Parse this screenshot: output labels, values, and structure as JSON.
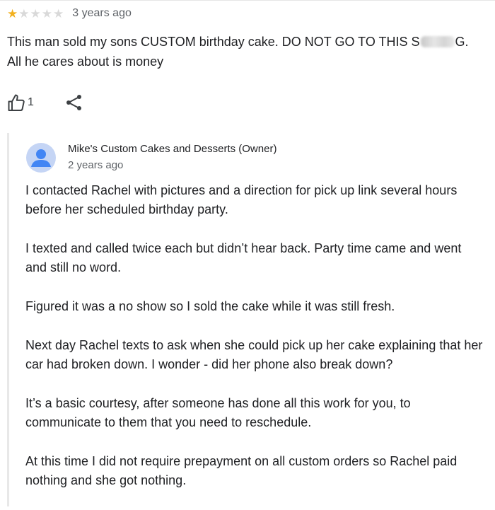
{
  "review": {
    "rating": 1,
    "max_rating": 5,
    "date": "3 years ago",
    "text_part1": "This man sold my sons CUSTOM birthday cake. DO NOT GO TO THIS S",
    "text_part2": "G. All he cares about is money",
    "like_count": "1"
  },
  "reply": {
    "owner_name": "Mike's Custom Cakes and Desserts (Owner)",
    "date": "2 years ago",
    "paragraphs": [
      "I contacted Rachel with pictures and a direction for pick up link several hours before her scheduled birthday party.",
      "I texted and called twice each but didn’t hear back. Party time came and went and still no word.",
      "Figured it was a no show so I sold the cake while it was still fresh.",
      "Next day Rachel texts to ask when she could pick up her cake explaining that her car had broken down. I wonder - did her phone also break down?",
      "It’s a basic courtesy, after someone has done all this work for you, to communicate to them that you need to reschedule.",
      "At this time I did not require prepayment on all custom orders so Rachel paid nothing and she got nothing."
    ]
  },
  "icons": {
    "star": "star-icon",
    "like": "thumbs-up-icon",
    "share": "share-icon",
    "avatar": "person-avatar-icon"
  },
  "colors": {
    "star_filled": "#f2b01e",
    "star_empty": "#d9d9d9",
    "avatar_bg": "#c5d5f5",
    "avatar_fg": "#4285f4"
  }
}
